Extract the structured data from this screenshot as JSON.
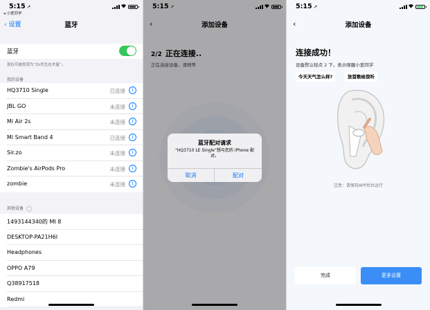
{
  "settings_screen": {
    "status": {
      "time": "5:15",
      "back_to_app": "◂ 小爱同学"
    },
    "back_label": "设置",
    "title": "蓝牙",
    "bluetooth_label": "蓝牙",
    "bluetooth_on": true,
    "discoverable_note": "现在可被发现为“Zo先生在木星”。",
    "my_devices_header": "我的设备",
    "my_devices": [
      {
        "name": "HQ3710 Single",
        "status": "已连接"
      },
      {
        "name": "JBL GO",
        "status": "未连接"
      },
      {
        "name": "Mi Air 2s",
        "status": "未连接"
      },
      {
        "name": "Mi Smart Band 4",
        "status": "已连接"
      },
      {
        "name": "Sir.zo",
        "status": "未连接"
      },
      {
        "name": "Zombie's AirPods Pro",
        "status": "未连接"
      },
      {
        "name": "zombie",
        "status": "未连接"
      }
    ],
    "other_devices_header": "其他设备",
    "other_devices": [
      "1493144340的 MI 8",
      "DESKTOP-PA21H6I",
      "Headphones",
      "OPPO A79",
      "Q38917518",
      "Redmi"
    ]
  },
  "pairing_screen": {
    "status": {
      "time": "5:15"
    },
    "title": "添加设备",
    "step_number": "2/2",
    "step_text": "正在连接..",
    "subtitle": "正在连接设备，请稍等",
    "dialog": {
      "title": "蓝牙配对请求",
      "message": "“HQ3710 LE Single”想与您的 iPhone 配对。",
      "cancel": "取消",
      "pair": "配对"
    }
  },
  "success_screen": {
    "status": {
      "time": "5:15"
    },
    "title": "添加设备",
    "heading": "连接成功！",
    "tip": "设备默认轻点 2 下，表示唤醒小爱同学",
    "examples": [
      "今天天气怎么样?",
      "放首歌给我听"
    ],
    "notice": "注意：请保持APP后台运行",
    "done_button": "完成",
    "more_settings_button": "更多设置"
  },
  "colors": {
    "ios_blue": "#0a7aff",
    "toggle_green": "#34c759",
    "primary_button": "#3a8ef6",
    "pairing_overlay": "#a9a9ab"
  },
  "icons": [
    "back-chevron-icon",
    "info-icon",
    "signal-icon",
    "wifi-icon",
    "battery-icon",
    "location-arrow-icon",
    "earbud-illustration"
  ]
}
